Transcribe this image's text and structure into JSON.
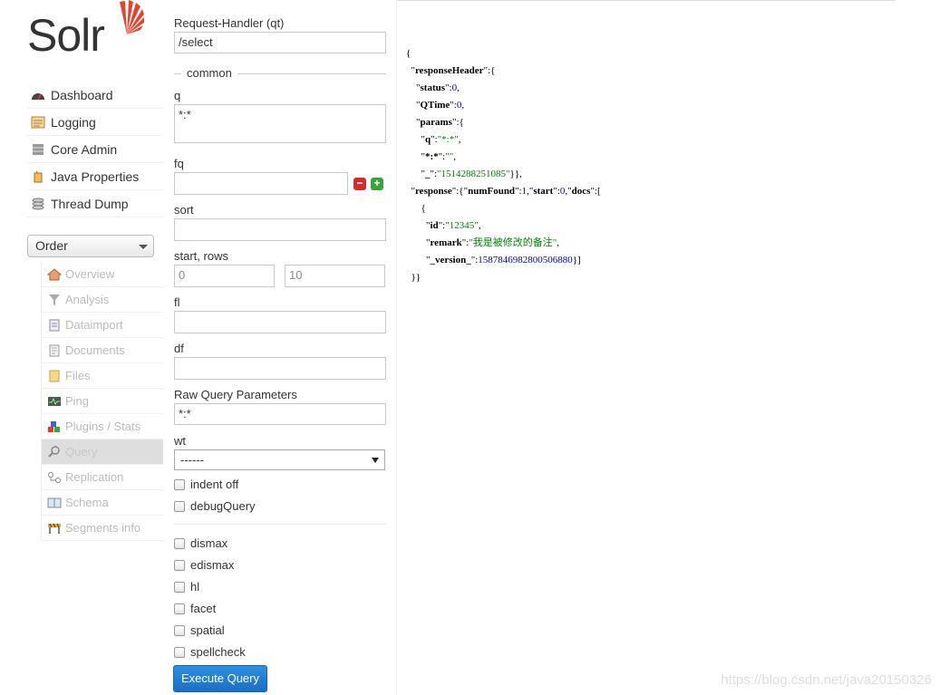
{
  "logo": {
    "text": "Solr"
  },
  "main_nav": [
    {
      "label": "Dashboard",
      "icon": "dashboard-icon"
    },
    {
      "label": "Logging",
      "icon": "logging-icon"
    },
    {
      "label": "Core Admin",
      "icon": "core-admin-icon"
    },
    {
      "label": "Java Properties",
      "icon": "java-properties-icon"
    },
    {
      "label": "Thread Dump",
      "icon": "thread-dump-icon"
    }
  ],
  "core_selector": {
    "value": "Order"
  },
  "core_menu": [
    {
      "label": "Overview",
      "icon": "overview-icon"
    },
    {
      "label": "Analysis",
      "icon": "analysis-icon"
    },
    {
      "label": "Dataimport",
      "icon": "dataimport-icon"
    },
    {
      "label": "Documents",
      "icon": "documents-icon"
    },
    {
      "label": "Files",
      "icon": "files-icon"
    },
    {
      "label": "Ping",
      "icon": "ping-icon"
    },
    {
      "label": "Plugins / Stats",
      "icon": "plugins-icon"
    },
    {
      "label": "Query",
      "icon": "query-icon",
      "active": true
    },
    {
      "label": "Replication",
      "icon": "replication-icon"
    },
    {
      "label": "Schema",
      "icon": "schema-icon"
    },
    {
      "label": "Segments info",
      "icon": "segments-icon"
    }
  ],
  "form": {
    "qt_label": "Request-Handler (qt)",
    "qt_value": "/select",
    "common_legend": "common",
    "q_label": "q",
    "q_value": "*:*",
    "fq_label": "fq",
    "fq_value": "",
    "sort_label": "sort",
    "sort_value": "",
    "start_rows_label": "start, rows",
    "start_value": "0",
    "rows_value": "10",
    "fl_label": "fl",
    "fl_value": "",
    "df_label": "df",
    "df_value": "",
    "raw_label": "Raw Query Parameters",
    "raw_value": "*:*",
    "wt_label": "wt",
    "wt_value": "------",
    "indent_label": "indent off",
    "debug_label": "debugQuery",
    "options": [
      "dismax",
      "edismax",
      "hl",
      "facet",
      "spatial",
      "spellcheck"
    ],
    "execute_label": "Execute Query"
  },
  "response": {
    "status": "0",
    "qtime": "0",
    "param_q": "*:*",
    "param_star": "",
    "param_underscore": "1514288251085",
    "num_found": "1",
    "start": "0",
    "doc_id": "12345",
    "doc_remark": "我是被修改的备注",
    "doc_version": "1587846982800506880"
  },
  "watermark": "https://blog.csdn.net/java20150326",
  "colors": {
    "accent": "#1a6fc4",
    "string": "#008000",
    "number": "#0000c8"
  }
}
